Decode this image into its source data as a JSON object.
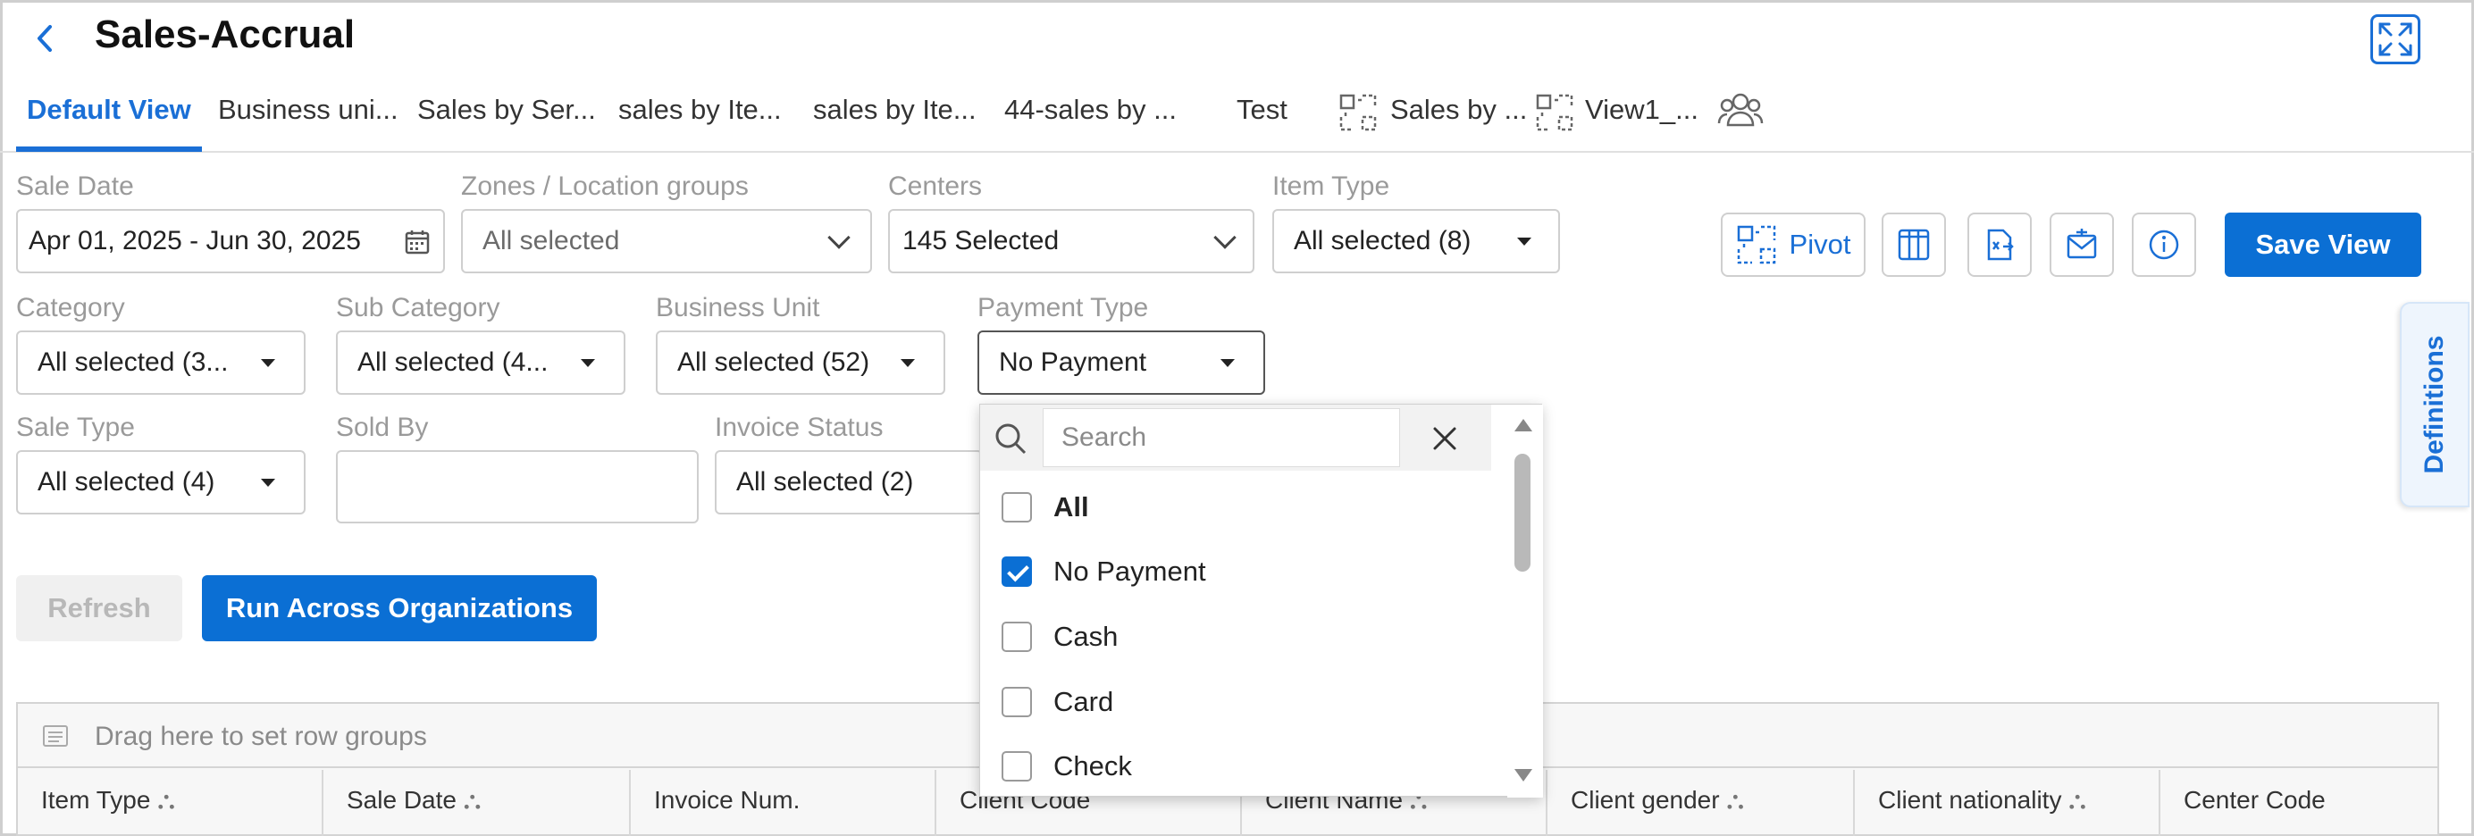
{
  "header": {
    "title": "Sales-Accrual"
  },
  "tabs": [
    {
      "label": "Default View",
      "active": true
    },
    {
      "label": "Business uni..."
    },
    {
      "label": "Sales by Ser..."
    },
    {
      "label": "sales by Ite..."
    },
    {
      "label": "sales by Ite..."
    },
    {
      "label": "44-sales by ..."
    },
    {
      "label": "Test"
    },
    {
      "label": "Sales by ...",
      "icon": "pivot-view-icon"
    },
    {
      "label": "View1_...",
      "icon": "pivot-view-icon"
    }
  ],
  "filters": {
    "sale_date": {
      "label": "Sale Date",
      "value": "Apr 01, 2025 - Jun 30, 2025"
    },
    "zones": {
      "label": "Zones / Location groups",
      "placeholder": "All selected"
    },
    "centers": {
      "label": "Centers",
      "value": "145 Selected"
    },
    "item_type": {
      "label": "Item Type",
      "value": "All selected (8)"
    },
    "category": {
      "label": "Category",
      "value": "All selected (3..."
    },
    "sub_category": {
      "label": "Sub Category",
      "value": "All selected (4..."
    },
    "business_unit": {
      "label": "Business Unit",
      "value": "All selected (52)"
    },
    "payment_type": {
      "label": "Payment Type",
      "value": "No Payment"
    },
    "sale_type": {
      "label": "Sale Type",
      "value": "All selected (4)"
    },
    "sold_by": {
      "label": "Sold By",
      "value": ""
    },
    "invoice_status": {
      "label": "Invoice Status",
      "value": "All selected (2)"
    }
  },
  "toolbar": {
    "pivot_label": "Pivot",
    "save_view_label": "Save View"
  },
  "actions": {
    "refresh_label": "Refresh",
    "run_label": "Run Across Organizations"
  },
  "definitions_tab": "Definitions",
  "dropdown": {
    "search_placeholder": "Search",
    "options": [
      {
        "label": "All",
        "checked": false,
        "bold": true
      },
      {
        "label": "No Payment",
        "checked": true
      },
      {
        "label": "Cash",
        "checked": false
      },
      {
        "label": "Card",
        "checked": false
      },
      {
        "label": "Check",
        "checked": false
      }
    ]
  },
  "grid": {
    "row_group_hint": "Drag here to set row groups",
    "columns": [
      "Item Type",
      "Sale Date",
      "Invoice Num.",
      "Client Code",
      "Client Name",
      "Client gender",
      "Client nationality",
      "Center Code"
    ]
  },
  "colors": {
    "accent": "#1a6fd6",
    "primary_button": "#0b6fd4",
    "checkbox_checked": "#0b6fd4"
  }
}
